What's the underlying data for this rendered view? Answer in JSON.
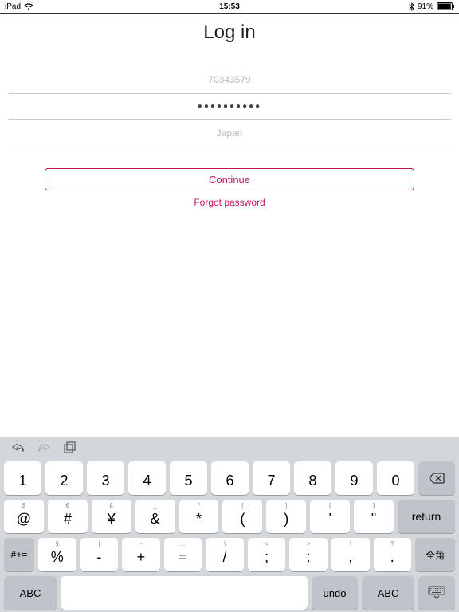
{
  "status": {
    "carrier": "iPad",
    "time": "15:53",
    "battery": "91%"
  },
  "header": {
    "title": "Log in"
  },
  "form": {
    "username": "70343579",
    "password_mask": "●●●●●●●●●●",
    "region": "Japan",
    "continue_label": "Continue",
    "forgot_label": "Forgot password"
  },
  "keyboard": {
    "row1": [
      {
        "main": "1",
        "sup": ""
      },
      {
        "main": "2",
        "sup": ""
      },
      {
        "main": "3",
        "sup": ""
      },
      {
        "main": "4",
        "sup": ""
      },
      {
        "main": "5",
        "sup": ""
      },
      {
        "main": "6",
        "sup": ""
      },
      {
        "main": "7",
        "sup": ""
      },
      {
        "main": "8",
        "sup": ""
      },
      {
        "main": "9",
        "sup": ""
      },
      {
        "main": "0",
        "sup": ""
      }
    ],
    "row2": [
      {
        "main": "@",
        "sup": "$"
      },
      {
        "main": "#",
        "sup": "€"
      },
      {
        "main": "¥",
        "sup": "£"
      },
      {
        "main": "&",
        "sup": "_"
      },
      {
        "main": "*",
        "sup": "^"
      },
      {
        "main": "(",
        "sup": "["
      },
      {
        "main": ")",
        "sup": "]"
      },
      {
        "main": "'",
        "sup": "{"
      },
      {
        "main": "\"",
        "sup": "}"
      }
    ],
    "return_label": "return",
    "row3_toggle": "#+=",
    "row3": [
      {
        "main": "%",
        "sup": "§"
      },
      {
        "main": "-",
        "sup": "|"
      },
      {
        "main": "+",
        "sup": "~"
      },
      {
        "main": "=",
        "sup": "…"
      },
      {
        "main": "/",
        "sup": "\\"
      },
      {
        "main": ";",
        "sup": "<"
      },
      {
        "main": ":",
        "sup": ">"
      },
      {
        "main": ",",
        "sup": "!"
      },
      {
        "main": ".",
        "sup": "?"
      }
    ],
    "zenkaku_label": "全角",
    "abc_label": "ABC",
    "undo_label": "undo"
  }
}
